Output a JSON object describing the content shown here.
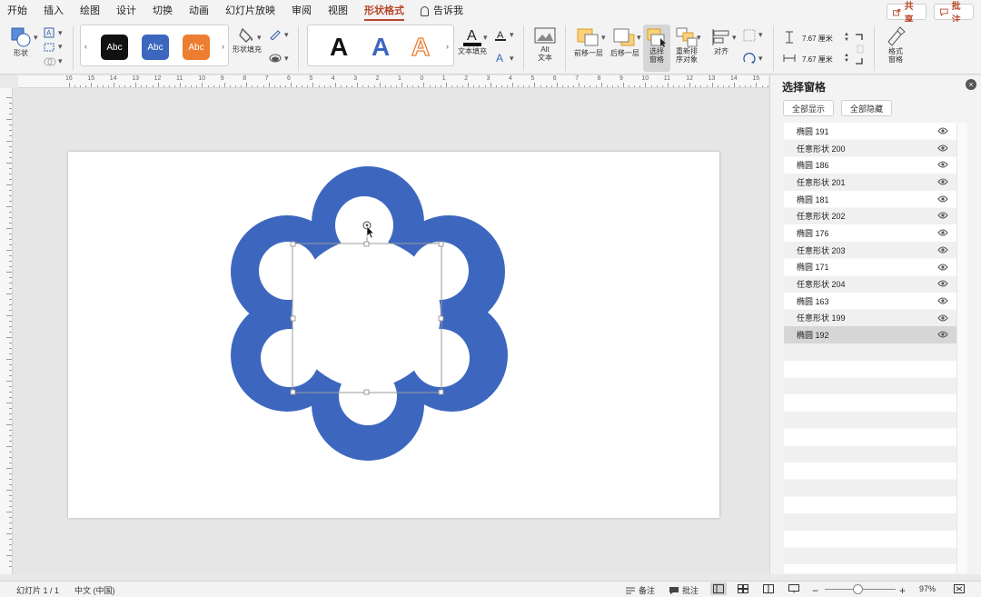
{
  "menu": {
    "items": [
      "开始",
      "插入",
      "绘图",
      "设计",
      "切换",
      "动画",
      "幻灯片放映",
      "审阅",
      "视图",
      "形状格式"
    ],
    "active": "形状格式",
    "tell_me": "告诉我",
    "share": "共享",
    "comments": "批注"
  },
  "ribbon": {
    "shape_label": "形状",
    "style_swatches": [
      "Abc",
      "Abc",
      "Abc"
    ],
    "swatch_colors": [
      "#111111",
      "#3d67bf",
      "#ed7d31"
    ],
    "shape_fill_label": "形状填充",
    "wordart_letters": [
      "A",
      "A",
      "A"
    ],
    "text_fill_label": "文本填充",
    "alt_text_label": "Alt\n文本",
    "bring_forward_label": "前移一层",
    "send_backward_label": "后移一层",
    "selection_pane_label": "选择\n窗格",
    "reorder_label": "重新排\n序对象",
    "align_label": "对齐",
    "height_value": "7.67 厘米",
    "width_value": "7.67 厘米",
    "format_pane_label": "格式\n窗格"
  },
  "ruler_numbers": [
    "16",
    "15",
    "14",
    "13",
    "12",
    "11",
    "10",
    "9",
    "8",
    "7",
    "6",
    "5",
    "4",
    "3",
    "2",
    "1",
    "0",
    "1",
    "2",
    "3",
    "4",
    "5",
    "6",
    "7",
    "8",
    "9",
    "10",
    "11",
    "12",
    "13",
    "14",
    "15",
    "16"
  ],
  "pane": {
    "title": "选择窗格",
    "show_all": "全部显示",
    "hide_all": "全部隐藏",
    "items": [
      {
        "label": "椭圆 191"
      },
      {
        "label": "任意形状 200"
      },
      {
        "label": "椭圆 186"
      },
      {
        "label": "任意形状 201"
      },
      {
        "label": "椭圆 181"
      },
      {
        "label": "任意形状 202"
      },
      {
        "label": "椭圆 176"
      },
      {
        "label": "任意形状 203"
      },
      {
        "label": "椭圆 171"
      },
      {
        "label": "任意形状 204"
      },
      {
        "label": "椭圆 163"
      },
      {
        "label": "任意形状 199"
      },
      {
        "label": "椭圆 192"
      }
    ],
    "selected_item": "椭圆 192"
  },
  "status": {
    "slide_counter": "幻灯片 1 / 1",
    "language": "中文 (中国)",
    "notes": "备注",
    "comments": "批注",
    "zoom": "97%"
  },
  "colors": {
    "accent": "#b7472a",
    "shape_blue": "#3d67bf"
  }
}
